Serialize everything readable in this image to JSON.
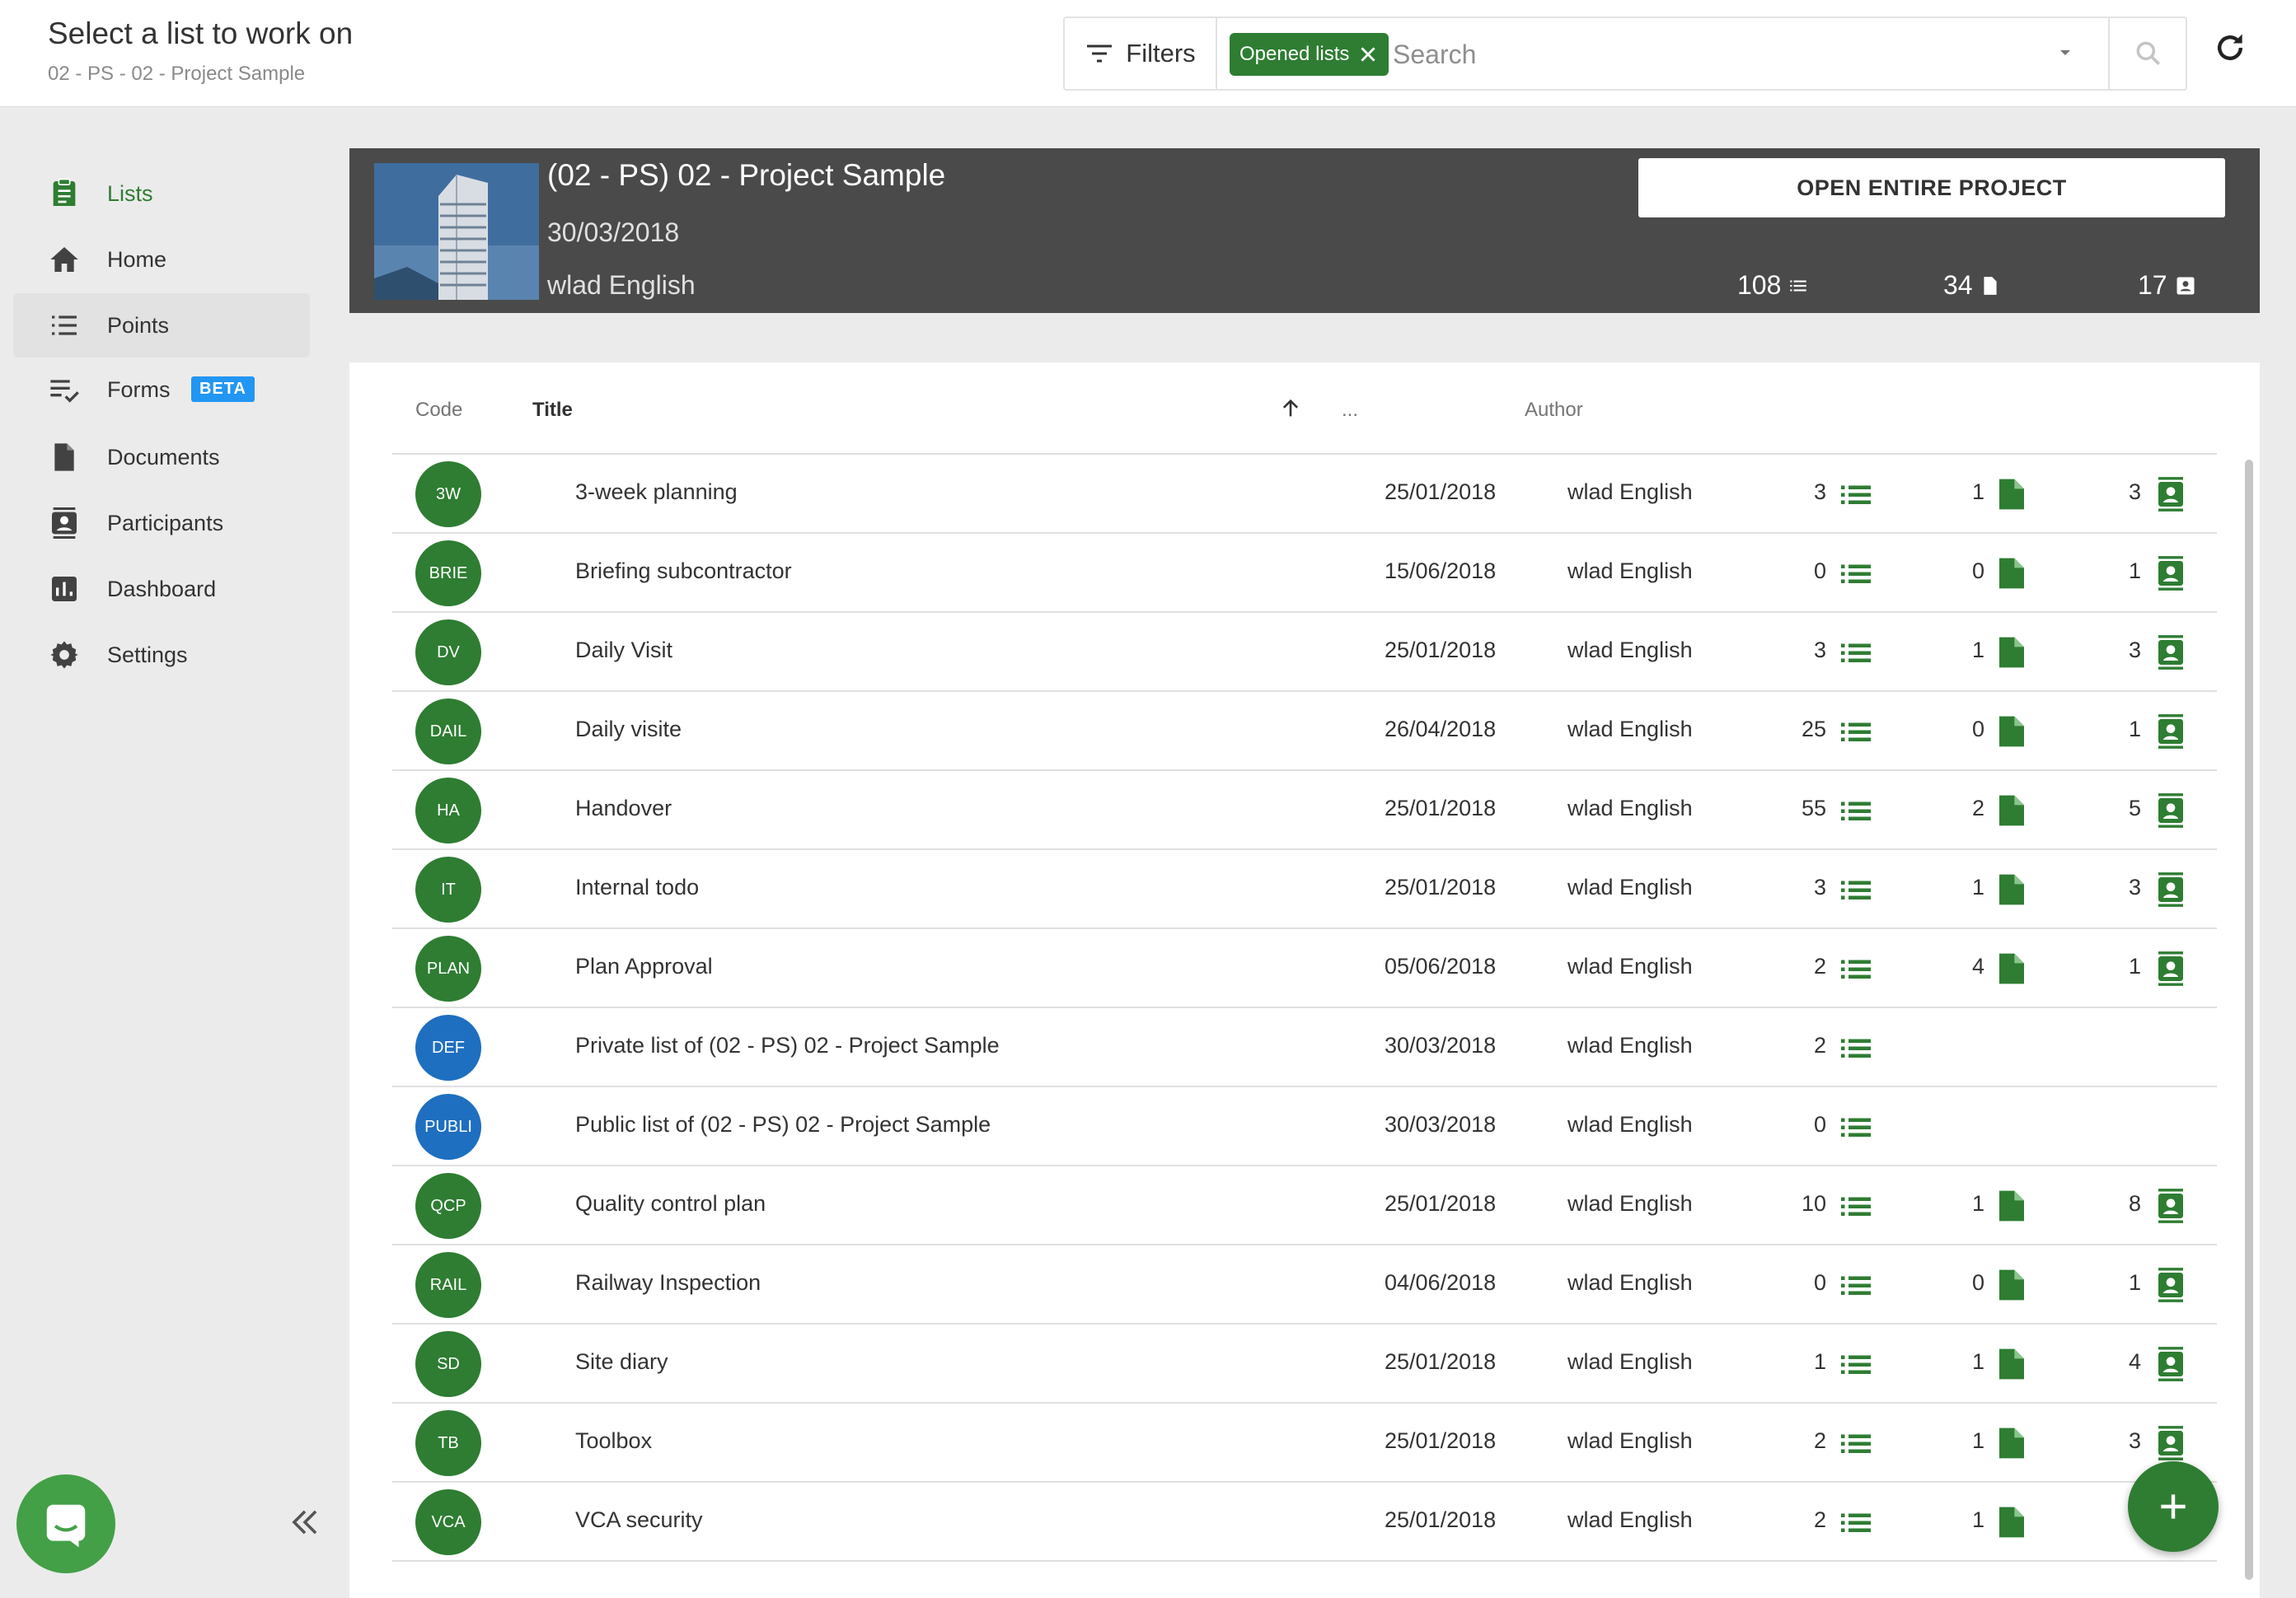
{
  "header": {
    "title": "Select a list to work on",
    "subtitle": "02 - PS - 02 - Project Sample",
    "filters_label": "Filters",
    "chip_label": "Opened lists",
    "search_placeholder": "Search"
  },
  "sidebar": {
    "items": [
      {
        "label": "Lists",
        "icon": "clipboard-icon"
      },
      {
        "label": "Home",
        "icon": "home-icon"
      },
      {
        "label": "Points",
        "icon": "list-icon"
      },
      {
        "label": "Forms",
        "icon": "checklist-icon",
        "badge": "BETA"
      },
      {
        "label": "Documents",
        "icon": "document-icon"
      },
      {
        "label": "Participants",
        "icon": "contact-icon"
      },
      {
        "label": "Dashboard",
        "icon": "chart-icon"
      },
      {
        "label": "Settings",
        "icon": "gear-icon"
      }
    ]
  },
  "project": {
    "title": "(02 - PS) 02 - Project Sample",
    "date": "30/03/2018",
    "author": "wlad English",
    "open_button": "OPEN ENTIRE PROJECT",
    "points": "108",
    "documents": "34",
    "participants": "17"
  },
  "table": {
    "columns": {
      "code": "Code",
      "title": "Title",
      "date": "...",
      "author": "Author"
    },
    "rows": [
      {
        "code": "3W",
        "title": "3-week planning",
        "date": "25/01/2018",
        "author": "wlad English",
        "points": "3",
        "docs": "1",
        "participants": "3",
        "color": "green"
      },
      {
        "code": "BRIE",
        "title": "Briefing subcontractor",
        "date": "15/06/2018",
        "author": "wlad English",
        "points": "0",
        "docs": "0",
        "participants": "1",
        "color": "green"
      },
      {
        "code": "DV",
        "title": "Daily Visit",
        "date": "25/01/2018",
        "author": "wlad English",
        "points": "3",
        "docs": "1",
        "participants": "3",
        "color": "green"
      },
      {
        "code": "DAIL",
        "title": "Daily visite",
        "date": "26/04/2018",
        "author": "wlad English",
        "points": "25",
        "docs": "0",
        "participants": "1",
        "color": "green"
      },
      {
        "code": "HA",
        "title": "Handover",
        "date": "25/01/2018",
        "author": "wlad English",
        "points": "55",
        "docs": "2",
        "participants": "5",
        "color": "green"
      },
      {
        "code": "IT",
        "title": "Internal todo",
        "date": "25/01/2018",
        "author": "wlad English",
        "points": "3",
        "docs": "1",
        "participants": "3",
        "color": "green"
      },
      {
        "code": "PLAN",
        "title": "Plan Approval",
        "date": "05/06/2018",
        "author": "wlad English",
        "points": "2",
        "docs": "4",
        "participants": "1",
        "color": "green"
      },
      {
        "code": "DEF",
        "title": "Private list of (02 - PS) 02 - Project Sample",
        "date": "30/03/2018",
        "author": "wlad English",
        "points": "2",
        "docs": null,
        "participants": null,
        "color": "blue"
      },
      {
        "code": "PUBLI",
        "title": "Public list of (02 - PS) 02 - Project Sample",
        "date": "30/03/2018",
        "author": "wlad English",
        "points": "0",
        "docs": null,
        "participants": null,
        "color": "blue"
      },
      {
        "code": "QCP",
        "title": "Quality control plan",
        "date": "25/01/2018",
        "author": "wlad English",
        "points": "10",
        "docs": "1",
        "participants": "8",
        "color": "green"
      },
      {
        "code": "RAIL",
        "title": "Railway Inspection",
        "date": "04/06/2018",
        "author": "wlad English",
        "points": "0",
        "docs": "0",
        "participants": "1",
        "color": "green"
      },
      {
        "code": "SD",
        "title": "Site diary",
        "date": "25/01/2018",
        "author": "wlad English",
        "points": "1",
        "docs": "1",
        "participants": "4",
        "color": "green"
      },
      {
        "code": "TB",
        "title": "Toolbox",
        "date": "25/01/2018",
        "author": "wlad English",
        "points": "2",
        "docs": "1",
        "participants": "3",
        "color": "green"
      },
      {
        "code": "VCA",
        "title": "VCA security",
        "date": "25/01/2018",
        "author": "wlad English",
        "points": "2",
        "docs": "1",
        "participants": null,
        "color": "green"
      }
    ]
  },
  "colors": {
    "accent": "#2e7d32",
    "private": "#1e6fc0",
    "beta": "#2196f3",
    "banner": "#4a4a4a"
  }
}
